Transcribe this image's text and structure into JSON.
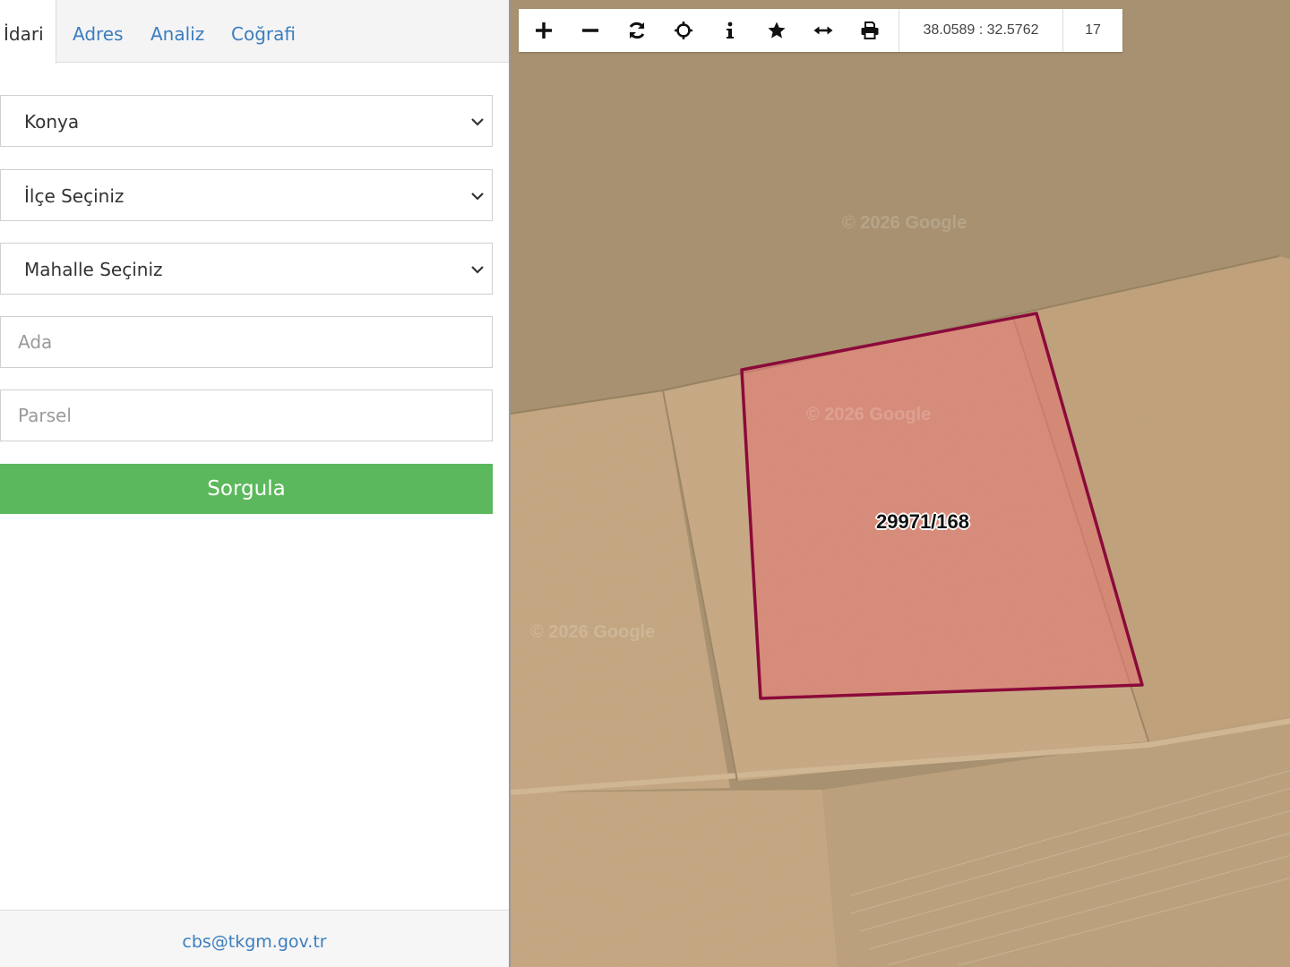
{
  "tabs": [
    {
      "label": "İdari",
      "active": true
    },
    {
      "label": "Adres",
      "active": false
    },
    {
      "label": "Analiz",
      "active": false
    },
    {
      "label": "Coğrafi",
      "active": false
    }
  ],
  "form": {
    "il": {
      "selected": "Konya"
    },
    "ilce": {
      "selected": "İlçe Seçiniz"
    },
    "mahalle": {
      "selected": "Mahalle Seçiniz"
    },
    "ada": {
      "placeholder": "Ada",
      "value": ""
    },
    "parsel": {
      "placeholder": "Parsel",
      "value": ""
    },
    "submit_label": "Sorgula"
  },
  "footer": {
    "email": "cbs@tkgm.gov.tr"
  },
  "map": {
    "toolbar": {
      "buttons": [
        "zoom-in-icon",
        "zoom-out-icon",
        "refresh-icon",
        "locate-icon",
        "info-icon",
        "favorite-icon",
        "measure-icon",
        "print-icon"
      ],
      "coordinates": "38.0589 : 32.5762",
      "zoom_level": "17"
    },
    "parcel_label": "29971/168",
    "watermark": "© 2026 Google",
    "colors": {
      "parcel_fill": "#e07a74",
      "parcel_stroke": "#8b0a3a",
      "submit_button": "#5cb85c",
      "link": "#3c7dbf"
    }
  }
}
